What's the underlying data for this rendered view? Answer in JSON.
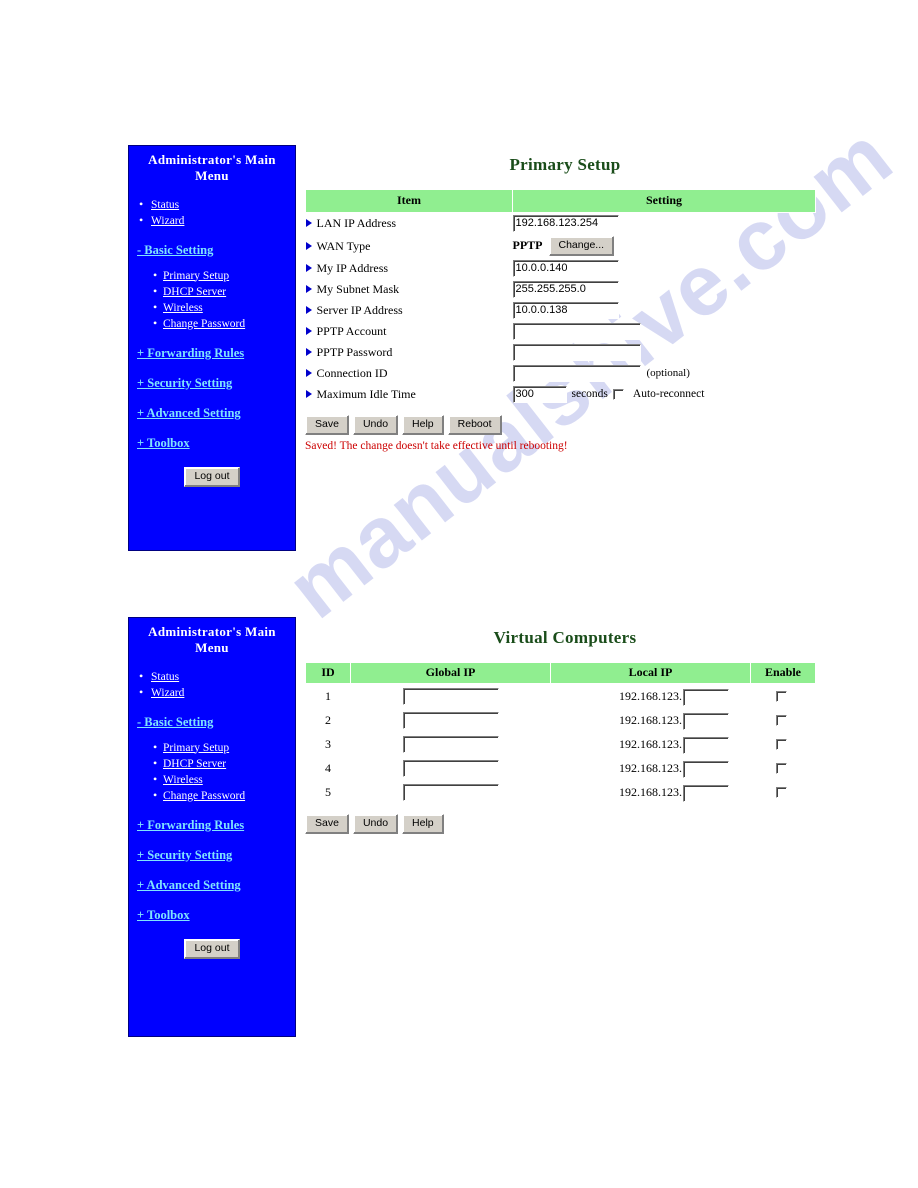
{
  "watermark": {
    "text": "manualshive.com"
  },
  "sidebar": {
    "title": "Administrator's Main Menu",
    "title_line1": "Administrator's Main",
    "title_line2": "Menu",
    "top_items": [
      {
        "label": "Status"
      },
      {
        "label": "Wizard"
      }
    ],
    "groups": [
      {
        "label": "- Basic Setting",
        "items": [
          {
            "label": "Primary Setup"
          },
          {
            "label": "DHCP Server"
          },
          {
            "label": "Wireless"
          },
          {
            "label": "Change Password"
          }
        ]
      },
      {
        "label": "+ Forwarding Rules",
        "items": []
      },
      {
        "label": "+ Security Setting",
        "items": []
      },
      {
        "label": "+ Advanced Setting",
        "items": []
      },
      {
        "label": "+ Toolbox",
        "items": []
      }
    ],
    "logout_label": "Log out"
  },
  "primary_setup": {
    "title": "Primary Setup",
    "columns": {
      "item": "Item",
      "setting": "Setting"
    },
    "rows": [
      {
        "label": "LAN IP Address",
        "value": "192.168.123.254"
      },
      {
        "label": "WAN Type",
        "value": "PPTP",
        "button": "Change..."
      },
      {
        "label": "My IP Address",
        "value": "10.0.0.140"
      },
      {
        "label": "My Subnet Mask",
        "value": "255.255.255.0"
      },
      {
        "label": "Server IP Address",
        "value": "10.0.0.138"
      },
      {
        "label": "PPTP Account",
        "value": ""
      },
      {
        "label": "PPTP Password",
        "value": ""
      },
      {
        "label": "Connection ID",
        "value": "",
        "note": "(optional)"
      },
      {
        "label": "Maximum Idle Time",
        "value": "300",
        "unit": "seconds",
        "checkbox_label": "Auto-reconnect",
        "checked": false
      }
    ],
    "buttons": [
      {
        "label": "Save"
      },
      {
        "label": "Undo"
      },
      {
        "label": "Help"
      },
      {
        "label": "Reboot"
      }
    ],
    "status_message": "Saved! The change doesn't take effective until rebooting!"
  },
  "virtual_computers": {
    "title": "Virtual Computers",
    "columns": {
      "id": "ID",
      "global_ip": "Global IP",
      "local_ip": "Local IP",
      "enable": "Enable"
    },
    "local_ip_prefix": "192.168.123.",
    "rows": [
      {
        "id": "1",
        "global_ip": "",
        "local_ip": "",
        "enable": false
      },
      {
        "id": "2",
        "global_ip": "",
        "local_ip": "",
        "enable": false
      },
      {
        "id": "3",
        "global_ip": "",
        "local_ip": "",
        "enable": false
      },
      {
        "id": "4",
        "global_ip": "",
        "local_ip": "",
        "enable": false
      },
      {
        "id": "5",
        "global_ip": "",
        "local_ip": "",
        "enable": false
      }
    ],
    "buttons": [
      {
        "label": "Save"
      },
      {
        "label": "Undo"
      },
      {
        "label": "Help"
      }
    ]
  },
  "colors": {
    "sidebar_bg": "#0000ff",
    "table_header": "#90ee90",
    "title": "#1a4d1a",
    "status": "#cc0000",
    "group_link": "#7fe3ff",
    "arrow": "#0000cc"
  }
}
